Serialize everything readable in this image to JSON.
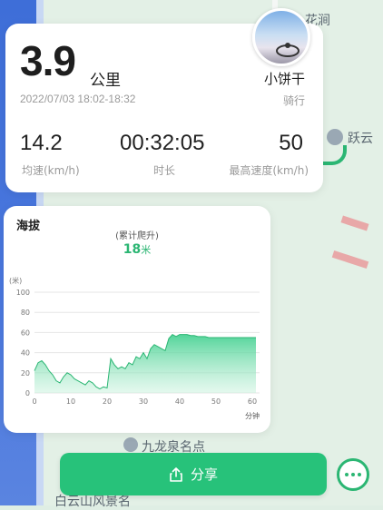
{
  "map": {
    "labels": [
      "花涧",
      "跃云",
      "九龙泉名点",
      "白云山风景名"
    ]
  },
  "summary": {
    "distance": "3.9",
    "distance_unit": "公里",
    "date_range": "2022/07/03 18:02-18:32",
    "username": "小饼干",
    "activity": "骑行",
    "stats": [
      {
        "value": "14.2",
        "label": "均速(km/h)"
      },
      {
        "value": "00:32:05",
        "label": "时长"
      },
      {
        "value": "50",
        "label": "最高速度(km/h)"
      }
    ]
  },
  "elevation": {
    "title": "海拔",
    "subtitle": "(累计爬升)",
    "gain_value": "18",
    "gain_unit": "米"
  },
  "chart_data": {
    "type": "area",
    "ylabel": "(米)",
    "xlabel": "分钟",
    "ylim": [
      0,
      100
    ],
    "xlim": [
      0,
      62
    ],
    "y_ticks": [
      0,
      20,
      40,
      60,
      80,
      100
    ],
    "x_ticks": [
      0,
      10,
      20,
      30,
      40,
      50,
      60
    ],
    "grid": true,
    "color": "#2bb673",
    "x": [
      0,
      1,
      2,
      3,
      4,
      5,
      6,
      7,
      8,
      9,
      10,
      11,
      12,
      13,
      14,
      15,
      16,
      17,
      18,
      19,
      20,
      21,
      22,
      23,
      24,
      25,
      26,
      27,
      28,
      29,
      30,
      31,
      32,
      33,
      34,
      35,
      36,
      37,
      38,
      39,
      40,
      41,
      42,
      43,
      44,
      45,
      46,
      47,
      48,
      49,
      50,
      51,
      52,
      53,
      54,
      55,
      56,
      57,
      58,
      59,
      60,
      61
    ],
    "y": [
      22,
      30,
      32,
      28,
      22,
      18,
      12,
      10,
      16,
      20,
      18,
      14,
      12,
      10,
      8,
      12,
      10,
      6,
      4,
      6,
      5,
      34,
      28,
      24,
      26,
      24,
      30,
      28,
      36,
      34,
      40,
      34,
      44,
      48,
      46,
      44,
      42,
      54,
      58,
      56,
      58,
      58,
      58,
      57,
      57,
      56,
      56,
      56,
      55,
      55,
      55,
      55,
      55,
      55,
      55,
      55,
      55,
      55,
      55,
      55,
      55,
      55
    ]
  },
  "actions": {
    "share_label": "分享"
  },
  "colors": {
    "accent": "#27c27a",
    "text": "#1e1e1e",
    "muted": "#9a9a9a"
  }
}
